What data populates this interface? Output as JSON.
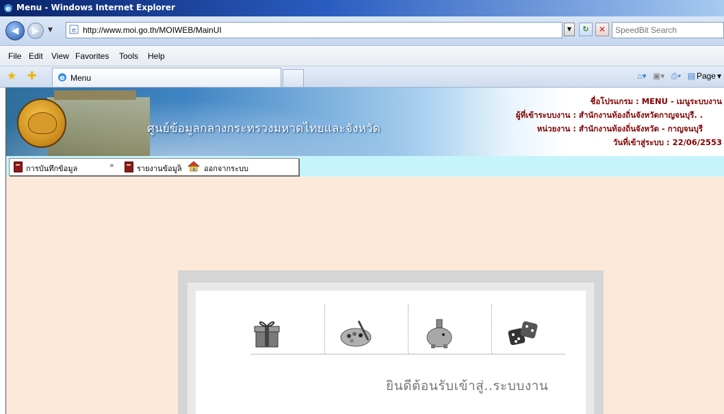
{
  "window": {
    "title": "Menu - Windows Internet Explorer"
  },
  "address": {
    "url": "http://www.moi.go.th/MOIWEB/MainUI"
  },
  "search": {
    "placeholder": "SpeedBit Search"
  },
  "menubar": {
    "items": [
      "File",
      "Edit",
      "View",
      "Favorites",
      "Tools",
      "Help"
    ]
  },
  "tab": {
    "label": "Menu"
  },
  "toolbar": {
    "page_label": "Page"
  },
  "banner": {
    "title": "ศูนย์ข้อมูลกลางกระทรวงมหาดไทยและจังหวัด",
    "program": "ชื่อโปรแกรม : MENU - เมนูระบบงาน",
    "user": "ผู้ที่เข้าระบบงาน : สำนักงานท้องถิ่นจังหวัดกาญจนบุรี. .",
    "unit": "หน่วยงาน : สำนักงานท้องถิ่นจังหวัด - กาญจนบุรี",
    "login_date": "วันที่เข้าสู่ระบบ : 22/06/2553"
  },
  "nav": {
    "items": [
      "การบันทึกข้อมูล",
      "รายงานข้อมูล",
      "ออกจากระบบ"
    ],
    "separator": "»"
  },
  "welcome": {
    "text": "ยินดีต้อนรับเข้าสู่..ระบบงาน"
  },
  "icons": [
    "gift-icon",
    "palette-icon",
    "piggy-bank-icon",
    "dice-icon"
  ]
}
